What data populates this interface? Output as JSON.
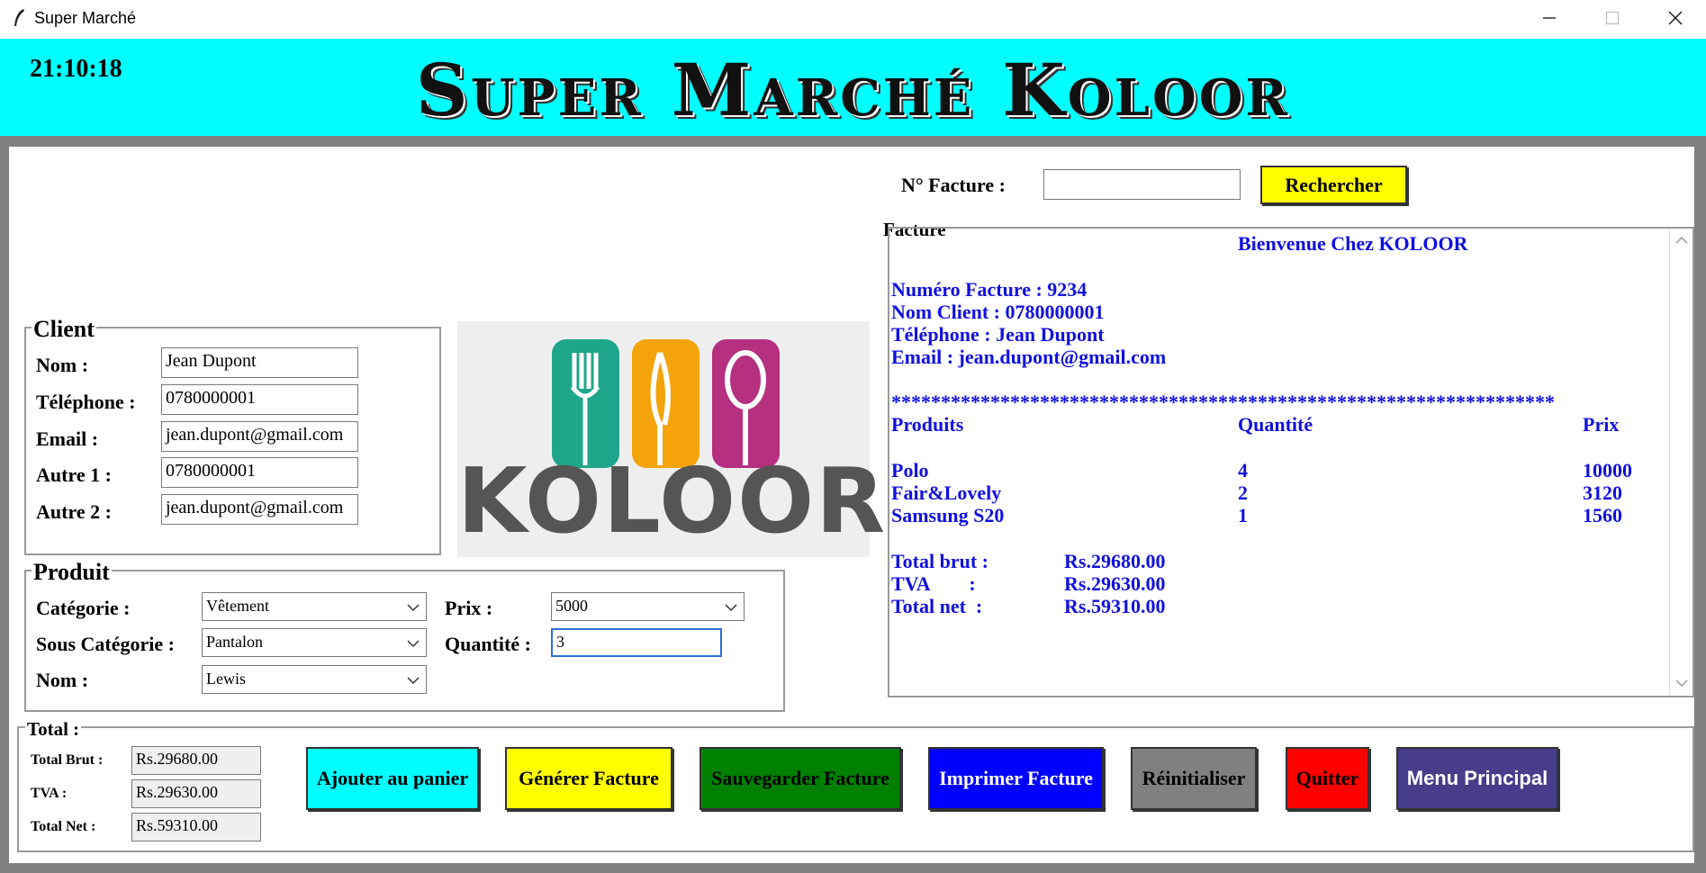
{
  "window": {
    "title": "Super Marché",
    "controls": [
      "minimize-icon",
      "maximize-icon",
      "close-icon"
    ]
  },
  "header": {
    "clock": "21:10:18",
    "brand": "Super Marché Koloor",
    "bg_color": "#00ffff"
  },
  "search": {
    "label": "N° Facture :",
    "value": "",
    "button": "Rechercher"
  },
  "client": {
    "legend": "Client",
    "fields": [
      {
        "label": "Nom :",
        "value": "Jean Dupont"
      },
      {
        "label": "Téléphone :",
        "value": "0780000001"
      },
      {
        "label": "Email :",
        "value": "jean.dupont@gmail.com"
      },
      {
        "label": "Autre 1 :",
        "value": "0780000001"
      },
      {
        "label": "Autre 2 :",
        "value": "jean.dupont@gmail.com"
      }
    ]
  },
  "logo": {
    "text": "KOLOOR",
    "colors": [
      "#1fa58a",
      "#f4a30a",
      "#b5307f"
    ]
  },
  "produit": {
    "legend": "Produit",
    "categorie": {
      "label": "Catégorie :",
      "value": "Vêtement"
    },
    "sous_categorie": {
      "label": "Sous Catégorie :",
      "value": "Pantalon"
    },
    "nom": {
      "label": "Nom :",
      "value": "Lewis"
    },
    "prix": {
      "label": "Prix :",
      "value": "5000"
    },
    "quantite": {
      "label": "Quantité :",
      "value": "3"
    }
  },
  "facture": {
    "legend": "Facture",
    "welcome": "Bienvenue Chez KOLOOR",
    "numero": "Numéro Facture : 9234",
    "nom_client": "Nom Client : 0780000001",
    "telephone": "Téléphone : Jean Dupont",
    "email": "Email : jean.dupont@gmail.com",
    "separator": "*******************************************************************",
    "columns": [
      "Produits",
      "Quantité",
      "Prix"
    ],
    "items": [
      {
        "produit": "Polo",
        "quantite": "4",
        "prix": "10000"
      },
      {
        "produit": "Fair&Lovely",
        "quantite": "2",
        "prix": "3120"
      },
      {
        "produit": "Samsung S20",
        "quantite": "1",
        "prix": "1560"
      }
    ],
    "totals": [
      {
        "label": "Total brut :",
        "value": "Rs.29680.00"
      },
      {
        "label": "TVA        :",
        "value": "Rs.29630.00"
      },
      {
        "label": "Total net  :",
        "value": "Rs.59310.00"
      }
    ],
    "text_color": "#1010e0"
  },
  "total": {
    "legend": "Total :",
    "rows": [
      {
        "label": "Total Brut :",
        "value": "Rs.29680.00"
      },
      {
        "label": "TVA :",
        "value": "Rs.29630.00"
      },
      {
        "label": "Total Net :",
        "value": "Rs.59310.00"
      }
    ]
  },
  "buttons": [
    {
      "label": "Ajouter au panier",
      "bg": "#00ffff",
      "fg": "#000000"
    },
    {
      "label": "Générer Facture",
      "bg": "#ffff00",
      "fg": "#000000"
    },
    {
      "label": "Sauvegarder Facture",
      "bg": "#008000",
      "fg": "#000000"
    },
    {
      "label": "Imprimer Facture",
      "bg": "#0000ff",
      "fg": "#ffffff"
    },
    {
      "label": "Réinitialiser",
      "bg": "#808080",
      "fg": "#000000"
    },
    {
      "label": "Quitter",
      "bg": "#ff0000",
      "fg": "#000000"
    },
    {
      "label": "Menu Principal",
      "bg": "#483d8b",
      "fg": "#ffffff"
    }
  ]
}
